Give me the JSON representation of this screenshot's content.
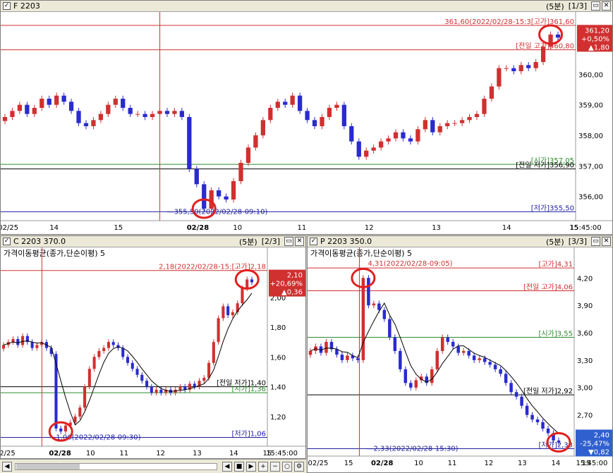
{
  "panes": [
    {
      "title": "F 2203",
      "period": "(5분)",
      "page": "[1/3]",
      "indicator": "",
      "current": {
        "price": "361,20",
        "pct": "+0,50%",
        "chg": "▲1,80",
        "color": "#d03030"
      },
      "ref_lines": [
        {
          "label": "361,60(2022/02/28-15:3[고가]361,60",
          "value": 361.6,
          "color": "#d03030"
        },
        {
          "label": "[전일 고가]360,80",
          "value": 360.8,
          "color": "#d03030"
        },
        {
          "label": "[시가]357,05",
          "value": 357.05,
          "color": "#2e8b2e"
        },
        {
          "label": "[전일 저가]356,90",
          "value": 356.9,
          "color": "#000000"
        },
        {
          "label": "[저가]355,50",
          "value": 355.5,
          "color": "#2020a0"
        }
      ],
      "low_annotation": "355,50(2022/02/28-09:10)"
    },
    {
      "title": "C 2203 370.0",
      "period": "(5분)",
      "page": "[2/3]",
      "indicator": "가격이동평균(종가,단순이평) 5",
      "current": {
        "price": "2,10",
        "pct": "+20,69%",
        "chg": "▲0,36",
        "color": "#d03030"
      },
      "ref_lines": [
        {
          "label": "2,18(2022/02/28-15:[고가]2,18",
          "value": 2.18,
          "color": "#d03030"
        },
        {
          "label": "[전일 저가]1,40",
          "value": 1.4,
          "color": "#000000"
        },
        {
          "label": "[시가]1,36",
          "value": 1.36,
          "color": "#2e8b2e"
        },
        {
          "label": "[저가]1,06",
          "value": 1.06,
          "color": "#2020a0"
        }
      ],
      "low_annotation": "1,06(2022/02/28-09:30)"
    },
    {
      "title": "P 2203 350.0",
      "period": "(5분)",
      "page": "[3/3]",
      "indicator": "가격이동평균(종가,단순이평) 5",
      "current": {
        "price": "2,40",
        "pct": "-25,47%",
        "chg": "▼0,82",
        "color": "#3060d0"
      },
      "ref_lines": [
        {
          "label": "[고가]4,31",
          "value": 4.31,
          "color": "#d03030"
        },
        {
          "label": "[전일 고가]4,06",
          "value": 4.06,
          "color": "#d03030"
        },
        {
          "label": "[시가]3,55",
          "value": 3.55,
          "color": "#2e8b2e"
        },
        {
          "label": "[전일 저가]2,92",
          "value": 2.92,
          "color": "#000000"
        },
        {
          "label": "[저가]2,33",
          "value": 2.33,
          "color": "#2020a0"
        }
      ],
      "high_annotation": "4,31(2022/02/28-09:05)",
      "low_annotation": "2,33(2022/02/28-15:30)"
    }
  ],
  "chart_data": [
    {
      "type": "candlestick",
      "title": "F 2203",
      "x_ticks": [
        "02/25",
        "14",
        "15",
        "02/28",
        "10",
        "11",
        "12",
        "13",
        "14",
        "15",
        "15:45:00"
      ],
      "y_ticks": [
        "356,00",
        "357,00",
        "358,00",
        "359,00",
        "360,00"
      ],
      "ylim": [
        355.3,
        361.9
      ],
      "close_path": [
        358.6,
        358.8,
        359.0,
        358.7,
        358.9,
        359.2,
        359.0,
        359.3,
        359.1,
        358.8,
        358.4,
        358.3,
        358.5,
        358.7,
        359.0,
        359.2,
        358.9,
        358.7,
        358.7,
        358.6,
        358.7,
        358.8,
        358.7,
        358.8,
        358.6,
        356.9,
        356.4,
        355.6,
        356.2,
        356.0,
        355.9,
        356.5,
        357.1,
        357.6,
        358.0,
        358.5,
        358.9,
        359.1,
        359.0,
        359.3,
        358.8,
        358.5,
        358.3,
        358.6,
        358.9,
        359.0,
        358.3,
        357.8,
        357.3,
        357.5,
        357.6,
        357.8,
        357.9,
        358.1,
        357.9,
        357.8,
        358.2,
        358.5,
        358.1,
        358.3,
        358.4,
        358.4,
        358.5,
        358.6,
        358.7,
        359.2,
        359.6,
        360.2,
        360.2,
        360.1,
        360.3,
        360.2,
        360.4,
        360.9,
        361.3,
        361.2
      ],
      "ma5": false
    },
    {
      "type": "candlestick",
      "title": "C 2203 370.0",
      "indicator": "가격이동평균(종가,단순이평) 5",
      "x_ticks": [
        "02/25",
        "02/28",
        "10",
        "11",
        "12",
        "13",
        "14",
        "15",
        "15:45:00"
      ],
      "y_ticks": [
        "1,20",
        "1,40",
        "1,60",
        "1,80",
        "2,00"
      ],
      "ylim": [
        1.02,
        2.24
      ],
      "close_path": [
        1.68,
        1.7,
        1.72,
        1.68,
        1.74,
        1.7,
        1.66,
        1.68,
        1.7,
        1.66,
        1.62,
        1.12,
        1.1,
        1.14,
        1.16,
        1.2,
        1.26,
        1.4,
        1.52,
        1.6,
        1.64,
        1.66,
        1.7,
        1.68,
        1.66,
        1.6,
        1.56,
        1.52,
        1.48,
        1.44,
        1.4,
        1.36,
        1.38,
        1.36,
        1.38,
        1.36,
        1.38,
        1.4,
        1.38,
        1.42,
        1.4,
        1.44,
        1.46,
        1.56,
        1.7,
        1.86,
        1.94,
        1.88,
        1.9,
        1.96,
        2.06,
        2.12,
        2.1
      ],
      "ma5": true
    },
    {
      "type": "candlestick",
      "title": "P 2203 350.0",
      "indicator": "가격이동평균(종가,단순이평) 5",
      "x_ticks": [
        "02/25",
        "15",
        "02/28",
        "10",
        "11",
        "12",
        "13",
        "14",
        "15",
        "15:45:00"
      ],
      "y_ticks": [
        "2,70",
        "3,00",
        "3,30",
        "3,60",
        "3,90",
        "4,20"
      ],
      "ylim": [
        2.28,
        4.38
      ],
      "close_path": [
        3.4,
        3.45,
        3.38,
        3.5,
        3.42,
        3.36,
        3.3,
        3.35,
        3.32,
        3.3,
        4.2,
        3.9,
        3.92,
        3.85,
        3.75,
        3.55,
        3.4,
        3.2,
        3.05,
        3.0,
        3.08,
        3.12,
        3.05,
        3.2,
        3.4,
        3.55,
        3.5,
        3.45,
        3.38,
        3.4,
        3.35,
        3.3,
        3.32,
        3.28,
        3.25,
        3.2,
        3.15,
        3.05,
        2.95,
        2.9,
        2.8,
        2.7,
        2.65,
        2.62,
        2.55,
        2.5,
        2.42,
        2.4
      ],
      "ma5": true
    }
  ]
}
